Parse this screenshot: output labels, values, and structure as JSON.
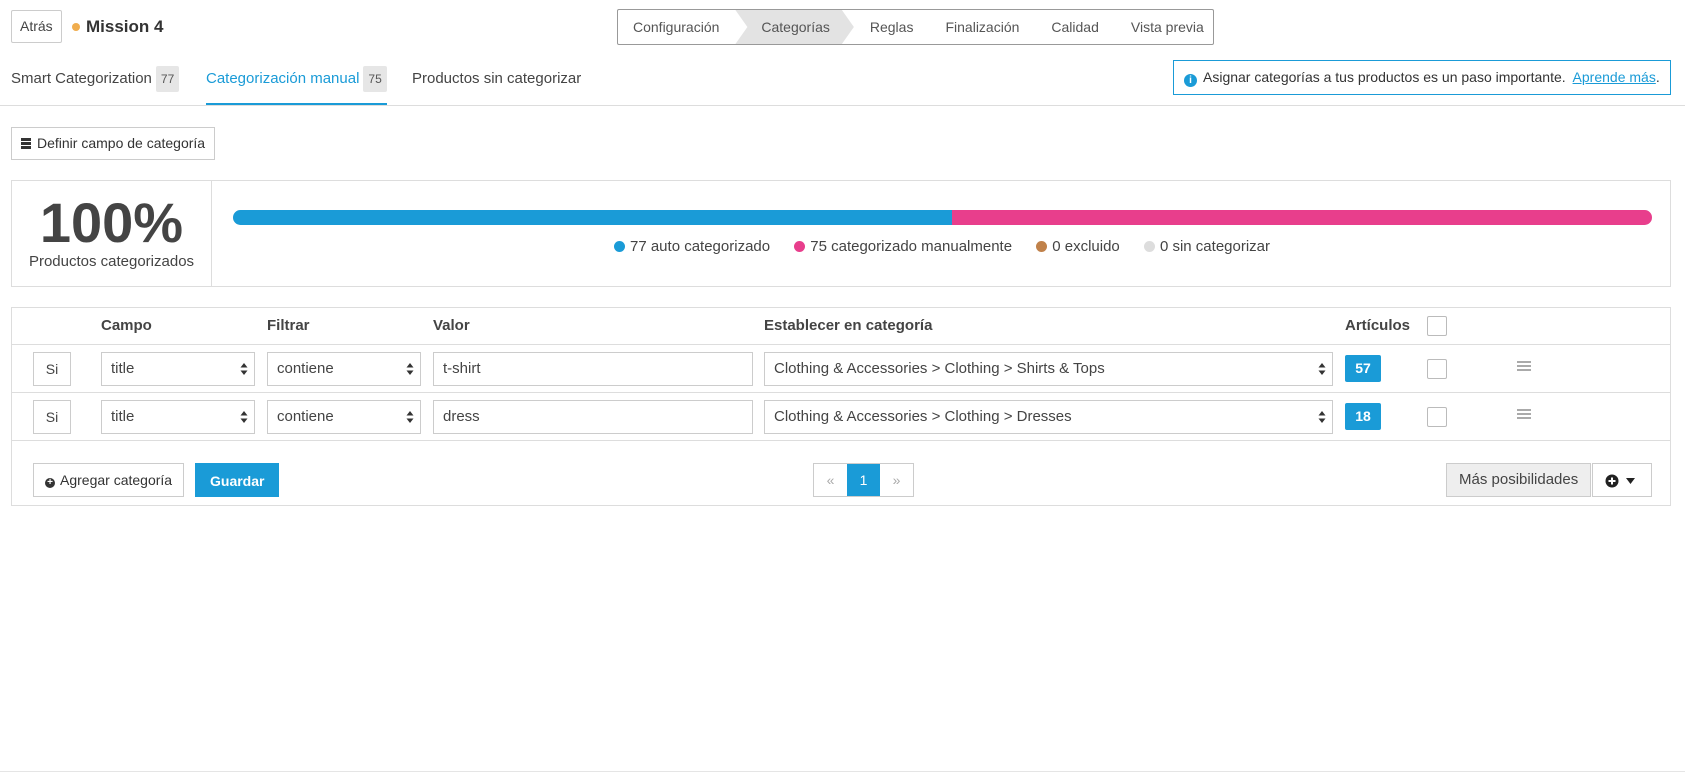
{
  "header": {
    "back_label": "Atrás",
    "mission_title": "Mission 4",
    "status_color": "#f0ad4e",
    "steps": [
      "Configuración",
      "Categorías",
      "Reglas",
      "Finalización",
      "Calidad",
      "Vista previa"
    ],
    "active_step": "Categorías"
  },
  "tabs": [
    {
      "label": "Smart Categorization",
      "badge": "77"
    },
    {
      "label": "Categorización manual",
      "badge": "75"
    },
    {
      "label": "Productos sin categorizar",
      "badge": ""
    }
  ],
  "active_tab": "Categorización manual",
  "info": {
    "icon": "info-icon",
    "text": "Asignar categorías a tus productos es un paso importante.",
    "link": "Aprende más",
    "trailing": "."
  },
  "define_button": {
    "label": "Definir campo de categoría",
    "icon": "database-icon"
  },
  "stats": {
    "percent": "100%",
    "label": "Productos categorizados",
    "progress": [
      {
        "value": 77,
        "color": "#1a9bd7"
      },
      {
        "value": 75,
        "color": "#e83e8c"
      },
      {
        "value": 0,
        "color": "#c0814a"
      },
      {
        "value": 0,
        "color": "#dddddd"
      }
    ],
    "legend": [
      {
        "text": "77 auto categorizado",
        "color": "#1a9bd7"
      },
      {
        "text": "75 categorizado manualmente",
        "color": "#e83e8c"
      },
      {
        "text": "0 excluido",
        "color": "#c0814a"
      },
      {
        "text": "0 sin categorizar",
        "color": "#dddddd"
      }
    ]
  },
  "table": {
    "headers": {
      "field": "Campo",
      "filter": "Filtrar",
      "value": "Valor",
      "category": "Establecer en categoría",
      "articles": "Artículos"
    },
    "rows": [
      {
        "cond": "Si",
        "field": "title",
        "filter": "contiene",
        "value": "t-shirt",
        "category": "Clothing & Accessories > Clothing > Shirts & Tops",
        "count": "57"
      },
      {
        "cond": "Si",
        "field": "title",
        "filter": "contiene",
        "value": "dress",
        "category": "Clothing & Accessories > Clothing > Dresses",
        "count": "18"
      }
    ]
  },
  "footer": {
    "add_label": "Agregar categoría",
    "save_label": "Guardar",
    "pager": {
      "prev": "«",
      "current": "1",
      "next": "»"
    },
    "more_label": "Más posibilidades"
  }
}
